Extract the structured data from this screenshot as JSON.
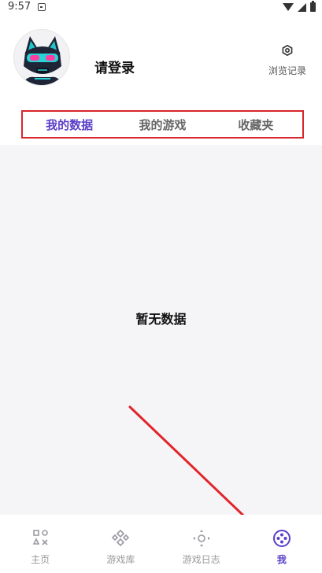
{
  "status_bar": {
    "time": "9:57"
  },
  "profile": {
    "login_text": "请登录",
    "history_label": "浏览记录"
  },
  "tabs": [
    {
      "label": "我的数据",
      "active": true
    },
    {
      "label": "我的游戏",
      "active": false
    },
    {
      "label": "收藏夹",
      "active": false
    }
  ],
  "content": {
    "empty_text": "暂无数据"
  },
  "bottom_nav": [
    {
      "label": "主页",
      "icon": "home-icon"
    },
    {
      "label": "游戏库",
      "icon": "gamepad-icon"
    },
    {
      "label": "游戏日志",
      "icon": "dpad-icon"
    },
    {
      "label": "我",
      "icon": "profile-icon",
      "active": true
    }
  ],
  "colors": {
    "accent": "#5a3fc9",
    "highlight_border": "#d8262c",
    "arrow": "#e0252b"
  }
}
